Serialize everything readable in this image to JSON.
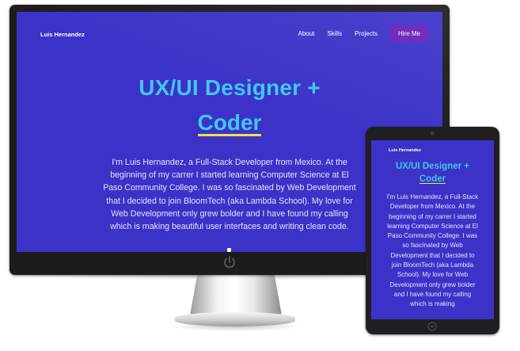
{
  "site": {
    "brand": "Luis Hernandez",
    "nav": [
      {
        "label": "About"
      },
      {
        "label": "Skills"
      },
      {
        "label": "Projects"
      }
    ],
    "cta_label": "Hire Me",
    "headline_line1": "UX/UI Designer +",
    "headline_line2": "Coder",
    "desktop_body": "I'm Luis Hernandez, a Full-Stack Developer from Mexico. At the beginning of my carrer I started learning Computer Science at El Paso Community College. I was so fascinated by Web Development that I decided to join BloomTech (aka Lambda School). My love for Web Development only grew bolder and I have found my calling which is making beautiful user interfaces and writing clean code.",
    "tablet_body": "I'm Luis Hernandez, a Full-Stack Developer from Mexico. At the beginning of my carrer I started learning Computer Science at El Paso Community College. I was so fascinated by Web Development that I decided to join BloomTech (aka Lambda School). My love for Web Development only grew bolder and I have found my calling which is making"
  },
  "colors": {
    "background": "#3c32c8",
    "accent_heading": "#3fc7ef",
    "underline": "#f3e14a",
    "cta_background": "#6a1fb8",
    "device_frame": "#1c1c1e"
  },
  "icons": {
    "monitor_power": "power-icon",
    "tablet_home": "home-button-icon"
  }
}
